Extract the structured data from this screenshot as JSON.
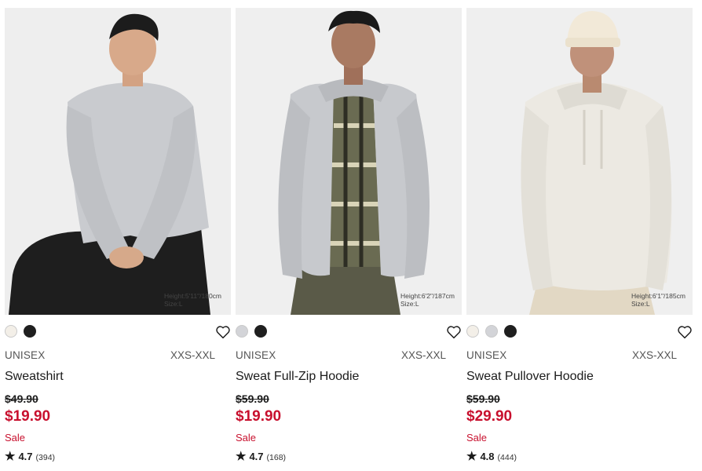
{
  "products": [
    {
      "gender": "UNISEX",
      "sizes": "XXS-XXL",
      "name": "Sweatshirt",
      "original_price": "$49.90",
      "sale_price": "$19.90",
      "sale_label": "Sale",
      "rating": "4.7",
      "review_count": "(394)",
      "model_info": [
        "Height:5'11\"/180cm",
        "Size:L"
      ],
      "colors": [
        "#f3efe8",
        "#1f1f1f"
      ],
      "garment_color": "#c9cbcf",
      "wishlist_icon": "heart-outline-icon"
    },
    {
      "gender": "UNISEX",
      "sizes": "XXS-XXL",
      "name": "Sweat Full-Zip Hoodie",
      "original_price": "$59.90",
      "sale_price": "$19.90",
      "sale_label": "Sale",
      "rating": "4.7",
      "review_count": "(168)",
      "model_info": [
        "Height:6'2\"/187cm",
        "Size:L"
      ],
      "colors": [
        "#d3d4d8",
        "#1f1f1f"
      ],
      "garment_color": "#c7c9cd",
      "wishlist_icon": "heart-outline-icon"
    },
    {
      "gender": "UNISEX",
      "sizes": "XXS-XXL",
      "name": "Sweat Pullover Hoodie",
      "original_price": "$59.90",
      "sale_price": "$29.90",
      "sale_label": "Sale",
      "rating": "4.8",
      "review_count": "(444)",
      "model_info": [
        "Height:6'1\"/185cm",
        "Size:L"
      ],
      "colors": [
        "#f3efe8",
        "#d3d4d8",
        "#1f1f1f"
      ],
      "garment_color": "#ece9e2",
      "wishlist_icon": "heart-outline-icon"
    }
  ],
  "accent_color": "#c8102e"
}
